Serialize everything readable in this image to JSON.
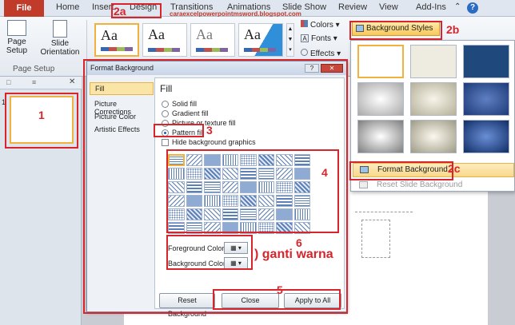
{
  "tabs": {
    "file": "File",
    "home": "Home",
    "insert": "Insert",
    "design": "Design",
    "transitions": "Transitions",
    "animations": "Animations",
    "slide_show": "Slide Show",
    "review": "Review",
    "view": "View",
    "addins": "Add-Ins"
  },
  "watermark": "caraexcelpowerpointmsword.blogspot.com",
  "page_setup": {
    "page_setup_label": "Page Setup",
    "slide_orientation_label": "Slide Orientation",
    "group_label": "Page Setup"
  },
  "themes": {
    "theme_text": "Aa"
  },
  "right_group": {
    "colors": "Colors",
    "fonts": "Fonts",
    "effects": "Effects",
    "background_styles": "Background Styles"
  },
  "slides": {
    "slide_number": "1"
  },
  "dialog": {
    "title": "Format Background",
    "categories": [
      "Fill",
      "Picture Corrections",
      "Picture Color",
      "Artistic Effects"
    ],
    "fill_heading": "Fill",
    "options": {
      "solid": "Solid fill",
      "gradient": "Gradient fill",
      "picture": "Picture or texture fill",
      "pattern": "Pattern fill",
      "hide": "Hide background graphics"
    },
    "foreground_label": "Foreground Color:",
    "background_label": "Background Color:",
    "reset_button": "Reset Background",
    "close_button": "Close",
    "apply_all_button": "Apply to All"
  },
  "dropdown": {
    "format_background": "Format Background...",
    "reset_slide_background": "Reset Slide Background"
  },
  "annotations": {
    "a1": "1",
    "a2a": "2a",
    "a2b": "2b",
    "a2c": "2c",
    "a3": "3",
    "a4": "4",
    "a5": "5",
    "a6": "6",
    "ganti_warna": "ganti warna"
  },
  "colors": {
    "annotation": "#d8252b",
    "file_tab": "#c13b2a"
  }
}
